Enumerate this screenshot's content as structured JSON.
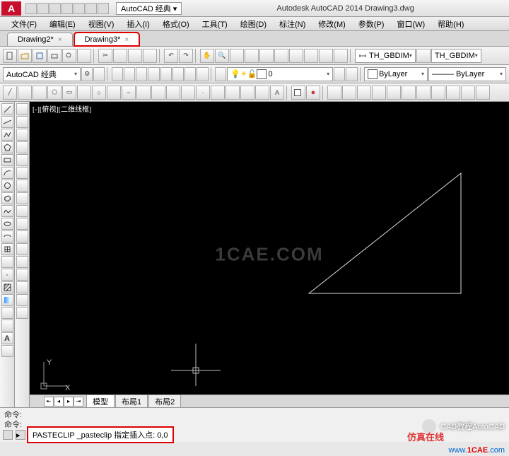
{
  "titlebar": {
    "app_logo_letter": "A",
    "workspace_label": "AutoCAD 经典",
    "title": "Autodesk AutoCAD 2014   Drawing3.dwg"
  },
  "menus": [
    "文件(F)",
    "编辑(E)",
    "视图(V)",
    "插入(I)",
    "格式(O)",
    "工具(T)",
    "绘图(D)",
    "标注(N)",
    "修改(M)",
    "参数(P)",
    "窗口(W)",
    "帮助(H)"
  ],
  "doc_tabs": [
    {
      "label": "Drawing2*",
      "active": false
    },
    {
      "label": "Drawing3*",
      "active": true
    }
  ],
  "toolbar2": {
    "workspace_combo": "AutoCAD 经典",
    "dimstyle1": "TH_GBDIM",
    "dimstyle2": "TH_GBDIM",
    "layer_combo": "0",
    "color_combo": "ByLayer",
    "linetype_combo": "ByLayer"
  },
  "viewport": {
    "label": "[-][俯视][二维线框]",
    "watermark": "1CAE.COM"
  },
  "layout_tabs": [
    "模型",
    "布局1",
    "布局2"
  ],
  "ucs": {
    "x": "X",
    "y": "Y"
  },
  "cmd": {
    "hist1": "命令:",
    "hist2": "命令:",
    "prompt": "PASTECLIP _pasteclip 指定插入点: 0,0"
  },
  "overlay": {
    "credit": "CAD教程AutoCAD",
    "slogan": "仿真在线",
    "url_prefix": "www.",
    "url_main": "1CAE",
    "url_suffix": ".com"
  },
  "icons": {
    "new": "new",
    "open": "open",
    "save": "save",
    "print": "print",
    "undo": "undo",
    "redo": "redo"
  }
}
